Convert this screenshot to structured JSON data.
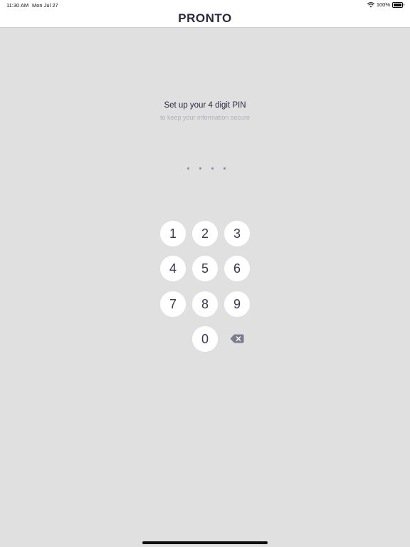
{
  "status_bar": {
    "time": "11:30 AM",
    "date": "Mon Jul 27",
    "battery": "100%",
    "icons": [
      "wifi-icon",
      "battery-icon"
    ]
  },
  "header": {
    "logo": "PRONTO"
  },
  "pin_setup": {
    "title": "Set up your 4 digit PIN",
    "subtitle": "to keep your information secure",
    "pin_length": 4
  },
  "keypad": {
    "keys": [
      "1",
      "2",
      "3",
      "4",
      "5",
      "6",
      "7",
      "8",
      "9",
      "0"
    ],
    "backspace_icon": "backspace-icon"
  },
  "colors": {
    "background": "#e0e0e0",
    "text": "#2b2940",
    "key_bg": "#ffffff",
    "backspace": "#7d7c8e"
  }
}
